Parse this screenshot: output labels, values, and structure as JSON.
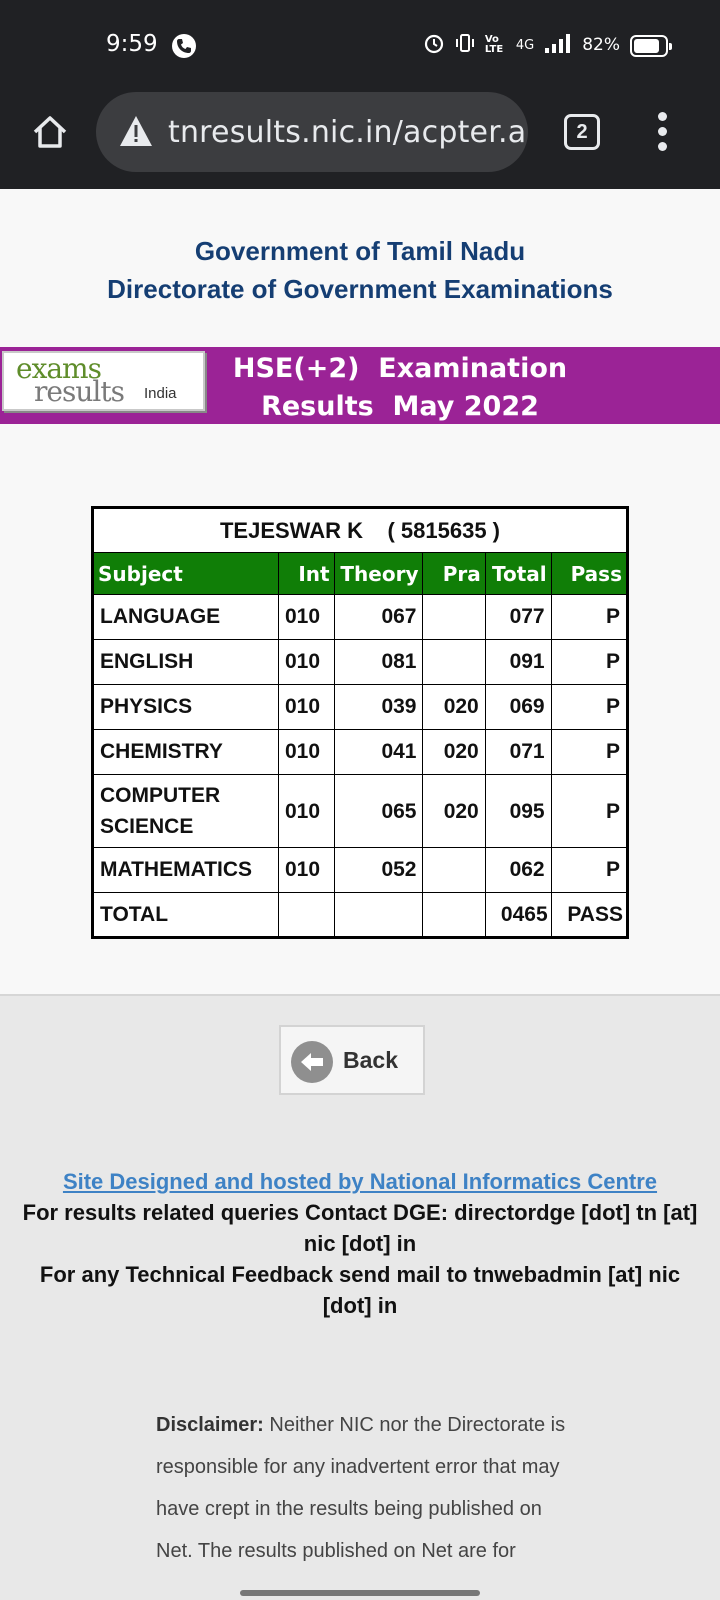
{
  "status_bar": {
    "time": "9:59",
    "network": "4G",
    "volte": "Vo LTE",
    "battery": "82%",
    "battery_level": 0.82
  },
  "browser": {
    "url": "tnresults.nic.in/acpter.as",
    "tab_count": "2"
  },
  "header": {
    "line1": "Government of Tamil Nadu",
    "line2": "Directorate of Government Examinations"
  },
  "banner": {
    "logo_exams": "exams",
    "logo_results": "results",
    "logo_india": "India",
    "title_line1": "HSE(+2)  Examination",
    "title_line2": "Results  May 2022"
  },
  "result": {
    "student_name": "TEJESWAR K",
    "roll_number": "( 5815635 )",
    "columns": [
      "Subject",
      "Int",
      "Theory",
      "Pra",
      "Total",
      "Pass"
    ],
    "rows": [
      {
        "subject": "LANGUAGE",
        "int": "010",
        "theory": "067",
        "pra": "",
        "total": "077",
        "pass": "P"
      },
      {
        "subject": "ENGLISH",
        "int": "010",
        "theory": "081",
        "pra": "",
        "total": "091",
        "pass": "P"
      },
      {
        "subject": "PHYSICS",
        "int": "010",
        "theory": "039",
        "pra": "020",
        "total": "069",
        "pass": "P"
      },
      {
        "subject": "CHEMISTRY",
        "int": "010",
        "theory": "041",
        "pra": "020",
        "total": "071",
        "pass": "P"
      },
      {
        "subject": "COMPUTER SCIENCE",
        "int": "010",
        "theory": "065",
        "pra": "020",
        "total": "095",
        "pass": "P"
      },
      {
        "subject": "MATHEMATICS",
        "int": "010",
        "theory": "052",
        "pra": "",
        "total": "062",
        "pass": "P"
      }
    ],
    "total_label": "TOTAL",
    "total_marks": "0465",
    "total_result": "PASS"
  },
  "back_button": {
    "label": "Back"
  },
  "footer": {
    "link_text": "Site Designed and hosted by National Informatics Centre",
    "contact": "For results related queries Contact DGE:  directordge [dot] tn [at] nic [dot] in",
    "feedback": "For any Technical Feedback send mail to tnwebadmin [at] nic [dot] in"
  },
  "disclaimer": {
    "label": "Disclaimer:",
    "text": " Neither NIC nor the Directorate is responsible for any inadvertent error that may have crept in the results being published on Net. The results published on Net are for"
  },
  "colors": {
    "banner": "#9b2396",
    "table_header": "#107e07",
    "title_blue": "#153e73",
    "link": "#3e82c5"
  }
}
